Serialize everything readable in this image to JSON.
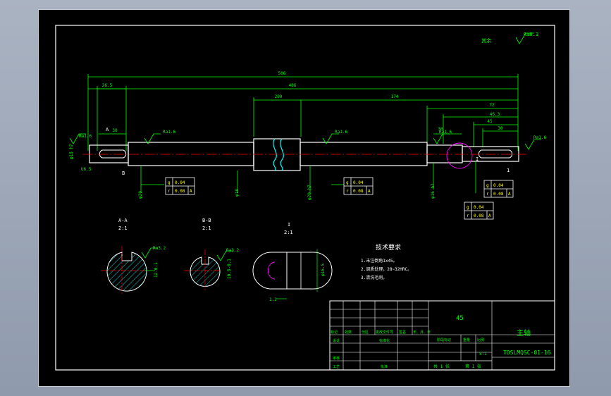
{
  "colors": {
    "background": "#000000",
    "frame": "#ffffff",
    "outline": "#ffffff",
    "dimension": "#00ff00",
    "centerline": "#ff0000",
    "hatch": "#00ffff",
    "section_arc": "#ff00ff",
    "tolerance": "#ffff00",
    "surround": "#9aa4b6"
  },
  "roughness_default": {
    "label": "其余",
    "value": "Ra6.3"
  },
  "dimensions": {
    "overall_length": "506",
    "total_486": "486",
    "left_26_5": "26.5",
    "mid_200": "200",
    "right_174": "174",
    "r_72": "72",
    "r_46_3": "46.3",
    "r_45": "45",
    "r_30": "30",
    "left_30": "30",
    "mid_30": "30",
    "dia_left": "φ15 h7",
    "slot_left": "U6.5",
    "dia_mid_a": "φ20",
    "dia_mid_b": "φ18",
    "dia_mid_c": "φ20 h7",
    "dia_right": "φ16 h7",
    "right_I": "I",
    "right_1": "1",
    "left_A": "A",
    "left_B": "B"
  },
  "roughness": {
    "left_end": "Ra1.6",
    "left_mid": "Ra1.6",
    "center": "Ra1.6",
    "right_mid": "Ra1.6",
    "right_end": "Ra1.6",
    "section_a": "Ra3.2",
    "section_b": "Ra3.2"
  },
  "tolerance_frames": {
    "left": [
      {
        "sym": "g",
        "val": "0.04"
      },
      {
        "sym": "r",
        "val": "0.08",
        "ref": "A"
      }
    ],
    "middle": [
      {
        "sym": "g",
        "val": "0.04"
      },
      {
        "sym": "r",
        "val": "0.08",
        "ref": "A"
      }
    ],
    "right_a": [
      {
        "sym": "g",
        "val": "0.04"
      },
      {
        "sym": "r",
        "val": "0.08",
        "ref": "A"
      }
    ],
    "right_b": [
      {
        "sym": "g",
        "val": "0.04"
      },
      {
        "sym": "r",
        "val": "0.08",
        "ref": "A"
      }
    ]
  },
  "sections": {
    "a_title": "A-A",
    "a_scale": "2:1",
    "a_dim": "12-0.1",
    "b_title": "B-B",
    "b_scale": "2:1",
    "b_dim": "10.5-0.1",
    "detail_title": "I",
    "detail_scale": "2:1",
    "detail_dim": "φ16.5",
    "detail_width": "1.2"
  },
  "notes": {
    "title": "技术要求",
    "items": [
      "1.未注倒角1x45。",
      "2.调质处理，28~32HRC。",
      "3.清洗毛刺。"
    ]
  },
  "title_block": {
    "material": "45",
    "part_name": "主轴",
    "drawing_no": "TDSLMQSC-01-16",
    "scale": "5:1",
    "sheet_total": "共 1 张",
    "sheet_no": "第 1 张",
    "rev_headers": [
      "标记",
      "处数",
      "分区",
      "更改文件号",
      "签名",
      "年、月、日"
    ],
    "design": "设计",
    "standard": "标准化",
    "review": "审核",
    "process": "工艺",
    "approve": "批准",
    "stage_mark": "阶段标记",
    "weight": "重量",
    "ratio": "比例"
  }
}
